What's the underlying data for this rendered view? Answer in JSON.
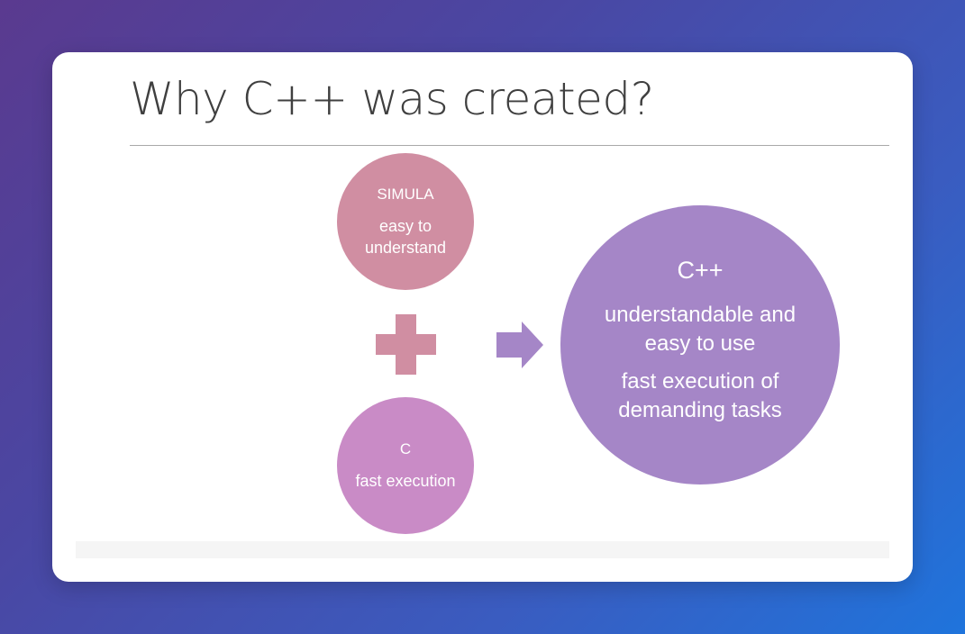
{
  "slide": {
    "title": "Why C++ was created?",
    "simula": {
      "name": "SIMULA",
      "description": "easy to understand"
    },
    "c": {
      "name": "C",
      "description": "fast execution"
    },
    "cpp": {
      "name": "C++",
      "point1": "understandable and easy to use",
      "point2": "fast execution of demanding tasks"
    }
  },
  "colors": {
    "simula": "#d08ea2",
    "c": "#c98bc6",
    "cpp": "#a586c7",
    "arrow": "#a586c7"
  }
}
